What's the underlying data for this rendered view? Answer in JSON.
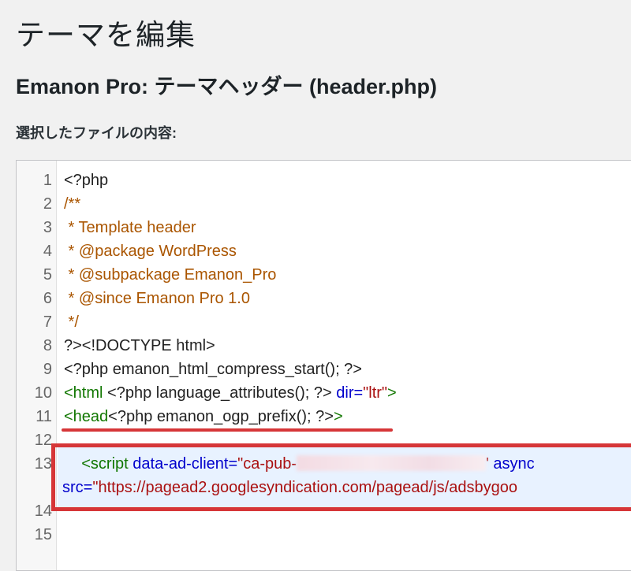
{
  "page": {
    "title": "テーマを編集",
    "file_heading": "Emanon Pro: テーマヘッダー (header.php)",
    "content_label": "選択したファイルの内容:"
  },
  "editor": {
    "line_numbers": [
      "1",
      "2",
      "3",
      "4",
      "5",
      "6",
      "7",
      "8",
      "9",
      "10",
      "11",
      "12",
      "13",
      "14",
      "15"
    ],
    "lines": {
      "l1": "<?php",
      "l2": "/**",
      "l3": " * Template header",
      "l4": " * @package WordPress",
      "l5": " * @subpackage Emanon_Pro",
      "l6": " * @since Emanon Pro 1.0",
      "l7": " */",
      "l8": "?><!DOCTYPE html>",
      "l9": "<?php emanon_html_compress_start(); ?>",
      "l10_open": "<html",
      "l10_php": " <?php language_attributes(); ?> ",
      "l10_attr": "dir=",
      "l10_val": "\"ltr\"",
      "l10_close": ">",
      "l11_open": "<head",
      "l11_php": "<?php emanon_ogp_prefix(); ?>",
      "l11_close": ">",
      "l13_indent": "    ",
      "l13_open": "<script",
      "l13_attr": " data-ad-client=",
      "l13_val": "\"ca-pub-",
      "l13_val_end": "'",
      "l13_attr2": " async",
      "l13b_attr": "src=",
      "l13b_val": "\"https://pagead2.googlesyndication.com/pagead/js/adsbygoo"
    }
  },
  "colors": {
    "comment": "#aa5500",
    "tag": "#117700",
    "attribute": "#0000cc",
    "string": "#aa1111",
    "highlight": "#d63638"
  }
}
